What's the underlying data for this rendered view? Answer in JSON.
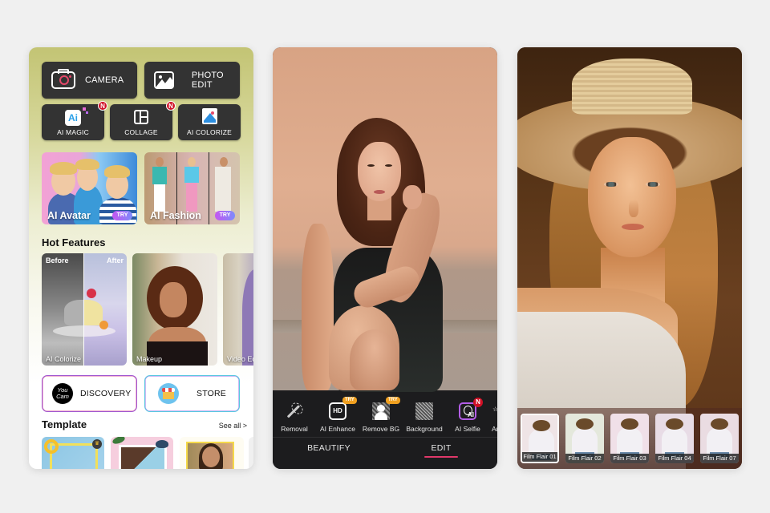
{
  "screen1": {
    "quick_actions": [
      {
        "label": "CAMERA",
        "icon": "camera-icon"
      },
      {
        "label": "PHOTO EDIT",
        "icon": "photo-icon"
      }
    ],
    "tools": [
      {
        "label": "AI MAGIC",
        "icon": "ai-magic-icon",
        "badge": "N"
      },
      {
        "label": "COLLAGE",
        "icon": "collage-icon",
        "badge": "N"
      },
      {
        "label": "AI COLORIZE",
        "icon": "ai-colorize-icon",
        "badge": ""
      }
    ],
    "promos": [
      {
        "title": "AI Avatar",
        "badge": "TRY"
      },
      {
        "title": "AI Fashion",
        "badge": "TRY"
      }
    ],
    "hot_features": {
      "title": "Hot Features",
      "items": [
        {
          "label": "AI Colorize",
          "before": "Before",
          "after": "After"
        },
        {
          "label": "Makeup"
        },
        {
          "label": "Video Ed"
        }
      ]
    },
    "discovery_label": "DISCOVERY",
    "discovery_logo": "You Cam",
    "store_label": "STORE",
    "template": {
      "title": "Template",
      "see_all": "See all >",
      "crown": "♛"
    }
  },
  "screen2": {
    "tools": [
      {
        "label": "Removal",
        "icon": "magic-wand-icon",
        "badge": ""
      },
      {
        "label": "AI Enhance",
        "icon": "hd-icon",
        "icon_text": "HD",
        "badge": "TRY"
      },
      {
        "label": "Remove BG",
        "icon": "remove-bg-icon",
        "badge": "TRY"
      },
      {
        "label": "Background",
        "icon": "background-icon",
        "badge": ""
      },
      {
        "label": "AI Selfie",
        "icon": "ai-selfie-icon",
        "icon_text": "AI",
        "badge": "N"
      },
      {
        "label": "Anima",
        "icon": "animation-icon",
        "badge": ""
      }
    ],
    "tabs": [
      {
        "label": "BEAUTIFY",
        "active": false
      },
      {
        "label": "EDIT",
        "active": true
      }
    ],
    "accent_color": "#e0386a"
  },
  "screen3": {
    "filters": [
      {
        "label": "Film Flair 01",
        "selected": true,
        "tint": "#efe4e6"
      },
      {
        "label": "Film Flair 02",
        "selected": false,
        "tint": "#e4e8dc"
      },
      {
        "label": "Film Flair 03",
        "selected": false,
        "tint": "#f0e0e8"
      },
      {
        "label": "Film Flair 04",
        "selected": false,
        "tint": "#e8dce6"
      },
      {
        "label": "Film Flair 07",
        "selected": false,
        "tint": "#eadce2"
      }
    ]
  }
}
